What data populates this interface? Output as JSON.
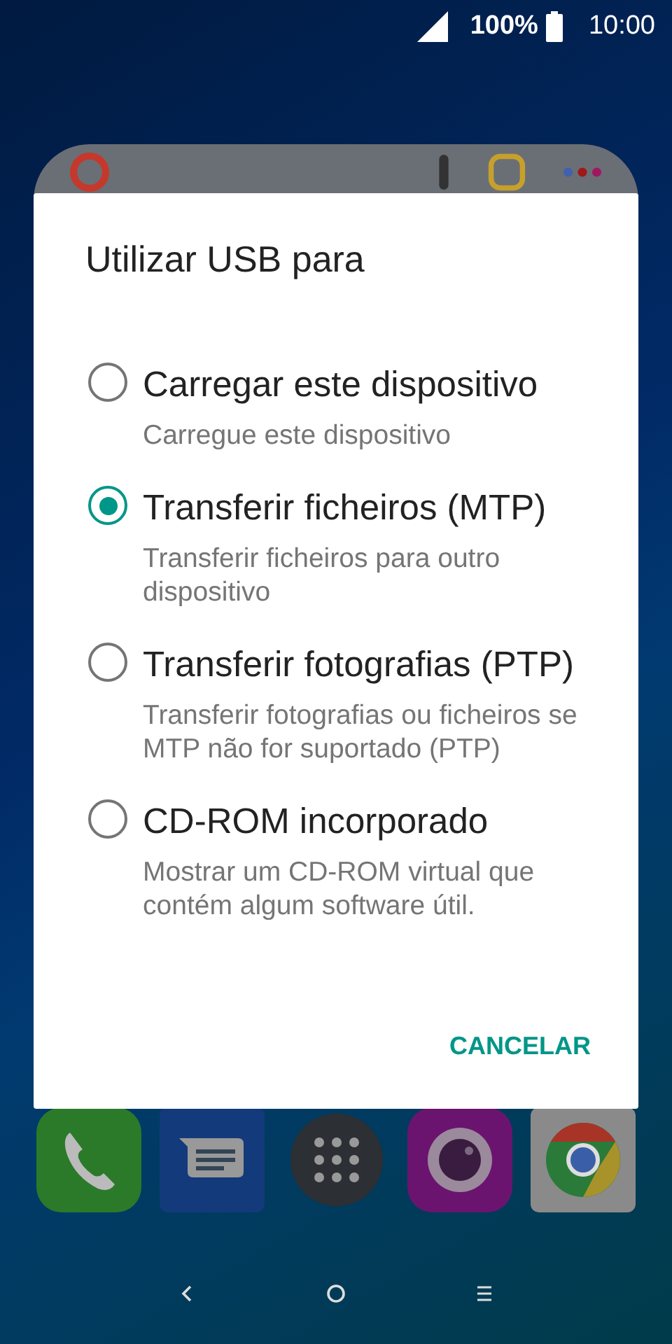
{
  "status_bar": {
    "battery": "100%",
    "time": "10:00"
  },
  "dialog": {
    "title": "Utilizar USB para",
    "options": [
      {
        "label": "Carregar este dispositivo",
        "description": "Carregue este dispositivo",
        "selected": false
      },
      {
        "label": "Transferir ficheiros (MTP)",
        "description": "Transferir ficheiros para outro dispositivo",
        "selected": true
      },
      {
        "label": "Transferir fotografias (PTP)",
        "description": "Transferir fotografias ou ficheiros se MTP não for suportado (PTP)",
        "selected": false
      },
      {
        "label": "CD-ROM incorporado",
        "description": "Mostrar um CD-ROM virtual que contém algum software útil.",
        "selected": false
      }
    ],
    "button": "CANCELAR"
  }
}
